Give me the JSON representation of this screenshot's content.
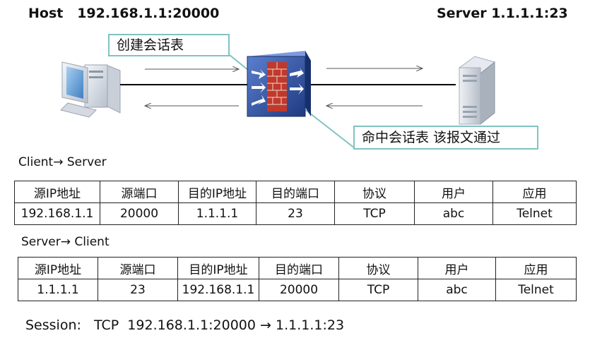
{
  "host_label": "Host   192.168.1.1:20000",
  "server_label": "Server 1.1.1.1:23",
  "callout_create": "创建会话表",
  "callout_hit": "命中会话表 该报文通过",
  "client_to_server": {
    "caption": "Client→ Server",
    "headers": [
      "源IP地址",
      "源端口",
      "目的IP地址",
      "目的端口",
      "协议",
      "用户",
      "应用"
    ],
    "values": [
      "192.168.1.1",
      "20000",
      "1.1.1.1",
      "23",
      "TCP",
      "abc",
      "Telnet"
    ]
  },
  "server_to_client": {
    "caption": "Server→ Client",
    "headers": [
      "源IP地址",
      "源端口",
      "目的IP地址",
      "目的端口",
      "协议",
      "用户",
      "应用"
    ],
    "values": [
      "1.1.1.1",
      "23",
      "192.168.1.1",
      "20000",
      "TCP",
      "abc",
      "Telnet"
    ]
  },
  "session": "Session:   TCP  192.168.1.1:20000 → 1.1.1.1:23",
  "colors": {
    "callout_border": "#7fc3c0",
    "firewall": "#2f4f9e",
    "firewall_brick": "#c0392b"
  },
  "icons": [
    "host-computer-icon",
    "firewall-icon",
    "server-icon"
  ]
}
